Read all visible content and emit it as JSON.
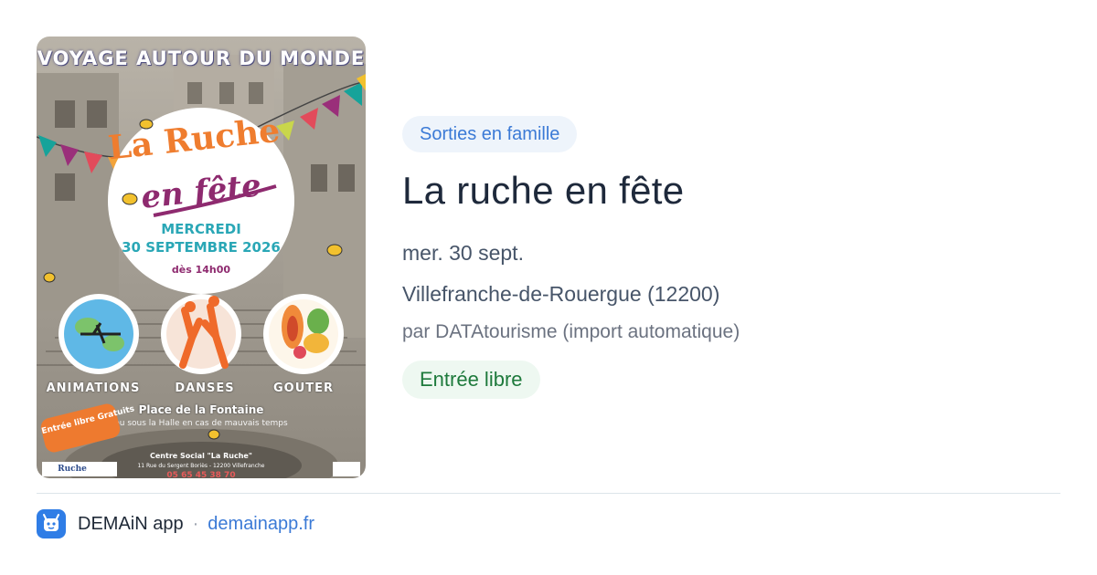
{
  "poster": {
    "header": "VOYAGE AUTOUR DU MONDE",
    "title_line1": "La Ruche",
    "title_line2": "en fête",
    "day": "MERCREDI",
    "date": "30 SEPTEMBRE 2026",
    "time": "dès 14h00",
    "activities": [
      "ANIMATIONS",
      "DANSES",
      "GOUTER"
    ],
    "place": "Place de la Fontaine",
    "place_alt": "ou sous la Halle en cas de mauvais temps",
    "badge": "Entrée libre Gratuits",
    "organizer": "Centre Social \"La Ruche\"",
    "address": "11 Rue du Sergent Boriès - 12200 Villefranche",
    "phone": "05 65 45 38 70",
    "logo_text": "Ruche",
    "colors": {
      "orange": "#ef7d2f",
      "purple": "#8e2a6f",
      "teal": "#2aa7b6"
    }
  },
  "event": {
    "category": "Sorties en famille",
    "title": "La ruche en fête",
    "date": "mer. 30 sept.",
    "location": "Villefranche-de-Rouergue (12200)",
    "source": "par DATAtourisme (import automatique)",
    "price": "Entrée libre"
  },
  "footer": {
    "app_icon": "bee-app-icon",
    "app_name": "DEMAiN app",
    "separator": "·",
    "url": "demainapp.fr"
  },
  "colors": {
    "tag_bg": "#eef4fb",
    "tag_text": "#3b7ad6",
    "price_bg": "#eef8f1",
    "price_text": "#1e7a3c",
    "title": "#1e293b",
    "link": "#3b7ad6",
    "app_icon_bg": "#2f7de6"
  }
}
